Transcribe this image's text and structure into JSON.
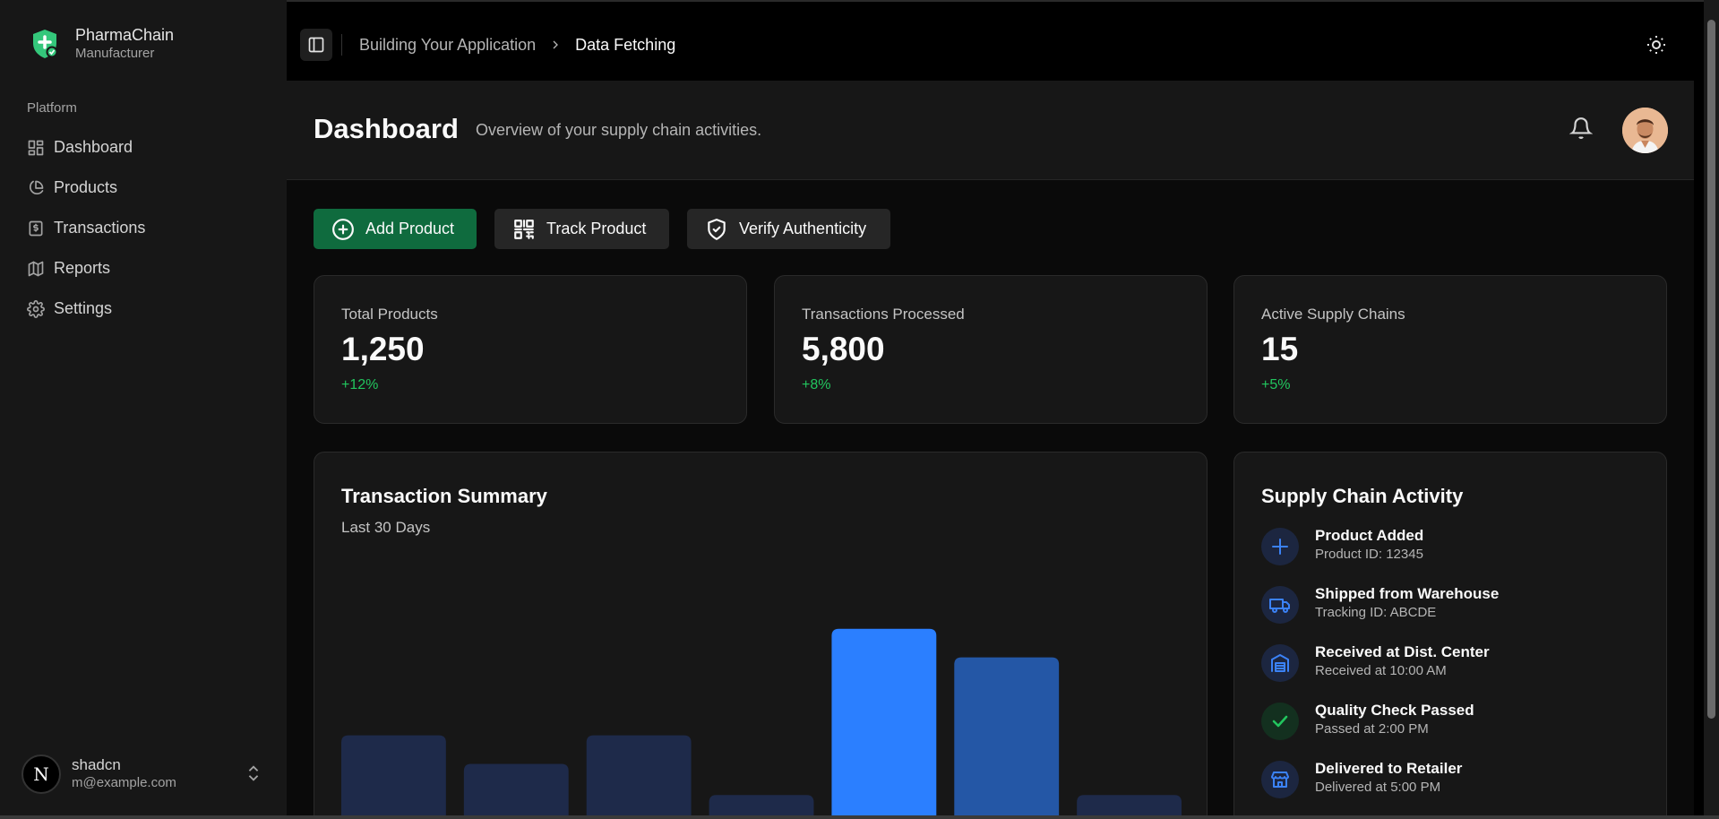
{
  "sidebar": {
    "brand_name": "PharmaChain",
    "brand_sub": "Manufacturer",
    "group_label": "Platform",
    "items": [
      {
        "label": "Dashboard",
        "icon": "dashboard-icon"
      },
      {
        "label": "Products",
        "icon": "pie-chart-icon"
      },
      {
        "label": "Transactions",
        "icon": "receipt-icon"
      },
      {
        "label": "Reports",
        "icon": "map-icon"
      },
      {
        "label": "Settings",
        "icon": "gear-icon"
      }
    ],
    "user": {
      "name": "shadcn",
      "email": "m@example.com",
      "avatar_letter": "N"
    }
  },
  "topbar": {
    "breadcrumb": [
      "Building Your Application",
      "Data Fetching"
    ]
  },
  "header": {
    "title": "Dashboard",
    "subtitle": "Overview of your supply chain activities."
  },
  "actions": [
    {
      "label": "Add Product",
      "icon": "plus-circle-icon"
    },
    {
      "label": "Track Product",
      "icon": "qr-code-icon"
    },
    {
      "label": "Verify Authenticity",
      "icon": "shield-check-icon"
    }
  ],
  "stats": [
    {
      "label": "Total Products",
      "value": "1,250",
      "delta": "+12%"
    },
    {
      "label": "Transactions Processed",
      "value": "5,800",
      "delta": "+8%"
    },
    {
      "label": "Active Supply Chains",
      "value": "15",
      "delta": "+5%"
    }
  ],
  "transaction_summary": {
    "title": "Transaction Summary",
    "subtitle": "Last 30 Days"
  },
  "chart_data": {
    "type": "bar",
    "title": "Transaction Summary",
    "subtitle": "Last 30 Days",
    "categories": [
      "",
      "",
      "",
      "",
      "",
      "",
      ""
    ],
    "values": [
      36,
      25,
      36,
      13,
      77,
      66,
      13
    ],
    "ylim": [
      0,
      100
    ],
    "colors": [
      "#1e2a4a",
      "#1e2a4a",
      "#1e2a4a",
      "#1e2a4a",
      "#2b7fff",
      "#2457a6",
      "#1e2a4a"
    ],
    "grid": false
  },
  "activity": {
    "title": "Supply Chain Activity",
    "items": [
      {
        "title": "Product Added",
        "desc": "Product ID: 12345",
        "icon": "plus-icon",
        "color": "#3b82f6"
      },
      {
        "title": "Shipped from Warehouse",
        "desc": "Tracking ID: ABCDE",
        "icon": "truck-icon",
        "color": "#3b82f6"
      },
      {
        "title": "Received at Dist. Center",
        "desc": "Received at 10:00 AM",
        "icon": "warehouse-icon",
        "color": "#3b82f6"
      },
      {
        "title": "Quality Check Passed",
        "desc": "Passed at 2:00 PM",
        "icon": "check-icon",
        "color": "#22c55e"
      },
      {
        "title": "Delivered to Retailer",
        "desc": "Delivered at 5:00 PM",
        "icon": "store-icon",
        "color": "#3b82f6"
      }
    ]
  },
  "colors": {
    "accent_green": "#0f6b3e",
    "positive": "#22c55e",
    "bar_highlight": "#2b7fff"
  }
}
